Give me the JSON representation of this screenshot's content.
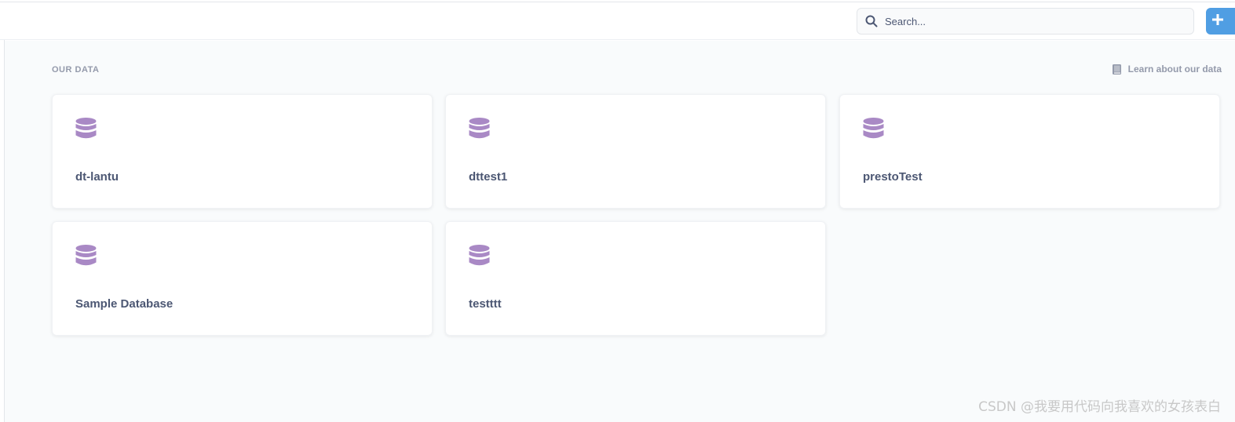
{
  "header": {
    "search": {
      "placeholder": "Search..."
    },
    "new_button": {
      "icon": "plus-icon"
    }
  },
  "main": {
    "section_title": "OUR DATA",
    "learn_link": {
      "label": "Learn about our data",
      "icon": "book-icon"
    },
    "databases": [
      {
        "name": "dt-lantu",
        "icon": "database-icon"
      },
      {
        "name": "dttest1",
        "icon": "database-icon"
      },
      {
        "name": "prestoTest",
        "icon": "database-icon"
      },
      {
        "name": "Sample Database",
        "icon": "database-icon"
      },
      {
        "name": "testttt",
        "icon": "database-icon"
      }
    ]
  },
  "colors": {
    "accent": "#509ee3",
    "database_icon": "#a989c5",
    "text_dark": "#4c5773",
    "text_light": "#949aab"
  },
  "watermark": "CSDN @我要用代码向我喜欢的女孩表白"
}
